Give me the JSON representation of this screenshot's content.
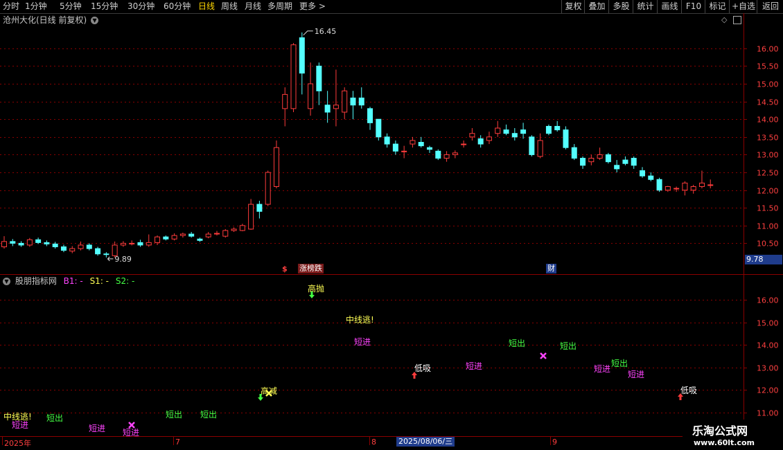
{
  "toolbar": {
    "periods": [
      "分时",
      "1分钟",
      "5分钟",
      "15分钟",
      "30分钟",
      "60分钟",
      "日线",
      "周线",
      "月线",
      "多周期",
      "更多 >"
    ],
    "active_period": "日线",
    "right_buttons": [
      "复权",
      "叠加",
      "多股",
      "统计",
      "画线",
      "F10",
      "标记",
      "+自选",
      "返回"
    ]
  },
  "main_panel": {
    "title": "沧州大化(日线 前复权)",
    "high_label": "16.45",
    "low_label": "9.89",
    "last_price_badge": "9.78",
    "event_badges": [
      "$",
      "涨榜跌",
      "财"
    ],
    "y_ticks": [
      "16.00",
      "15.50",
      "15.00",
      "14.50",
      "14.00",
      "13.50",
      "13.00",
      "12.50",
      "12.00",
      "11.50",
      "11.00",
      "10.50"
    ]
  },
  "indicator_panel": {
    "title": "股朋指标网",
    "b1_label": "B1: -",
    "s1_label": "S1: -",
    "s2_label": "S2: -",
    "y_ticks": [
      "16.00",
      "15.00",
      "14.00",
      "13.00",
      "12.00",
      "11.00"
    ],
    "signals": [
      {
        "text": "中线逃!",
        "color": "#ffff55"
      },
      {
        "text": "短进",
        "color": "#ff44ff"
      },
      {
        "text": "短出",
        "color": "#44ff44"
      },
      {
        "text": "短进",
        "color": "#ff44ff"
      },
      {
        "text": "短进",
        "color": "#ff44ff"
      },
      {
        "text": "短出",
        "color": "#44ff44"
      },
      {
        "text": "短出",
        "color": "#44ff44"
      },
      {
        "text": "高减",
        "color": "#ffff55"
      },
      {
        "text": "中线逃!",
        "color": "#ffff55"
      },
      {
        "text": "短进",
        "color": "#ff44ff"
      },
      {
        "text": "低吸",
        "color": "#ffffff"
      },
      {
        "text": "短进",
        "color": "#ff44ff"
      },
      {
        "text": "短出",
        "color": "#44ff44"
      },
      {
        "text": "短出",
        "color": "#44ff44"
      },
      {
        "text": "短进",
        "color": "#ff44ff"
      },
      {
        "text": "短出",
        "color": "#44ff44"
      },
      {
        "text": "短进",
        "color": "#ff44ff"
      },
      {
        "text": "低吸",
        "color": "#ffffff"
      },
      {
        "text": "高抛",
        "color": "#ffff55"
      }
    ]
  },
  "date_axis": {
    "labels": [
      "2025年",
      "7",
      "8",
      "9"
    ],
    "cursor_date": "2025/08/06/三"
  },
  "watermark": {
    "title": "乐淘公式网",
    "url": "www.60lt.com"
  },
  "colors": {
    "up": "#ff3c3c",
    "down": "#54ffff",
    "grid": "#8b0000",
    "accent": "#ffd700"
  },
  "chart_data": {
    "type": "candlestick",
    "title": "沧州大化(日线 前复权)",
    "ylim": [
      10.0,
      16.7
    ],
    "y_ticks": [
      10.5,
      11.0,
      11.5,
      12.0,
      12.5,
      13.0,
      13.5,
      14.0,
      14.5,
      15.0,
      15.5,
      16.0
    ],
    "high": 16.45,
    "low": 9.89,
    "candles": [
      [
        10.4,
        10.55,
        10.7,
        10.35
      ],
      [
        10.55,
        10.5,
        10.62,
        10.42
      ],
      [
        10.5,
        10.45,
        10.56,
        10.4
      ],
      [
        10.45,
        10.6,
        10.65,
        10.4
      ],
      [
        10.6,
        10.52,
        10.66,
        10.48
      ],
      [
        10.52,
        10.48,
        10.58,
        10.42
      ],
      [
        10.48,
        10.4,
        10.54,
        10.35
      ],
      [
        10.4,
        10.3,
        10.46,
        10.25
      ],
      [
        10.28,
        10.35,
        10.42,
        10.22
      ],
      [
        10.35,
        10.45,
        10.55,
        10.3
      ],
      [
        10.45,
        10.35,
        10.5,
        10.3
      ],
      [
        10.35,
        10.2,
        10.4,
        10.15
      ],
      [
        10.2,
        10.18,
        10.25,
        10.1
      ],
      [
        10.15,
        10.45,
        10.55,
        10.1
      ],
      [
        10.45,
        10.5,
        10.56,
        10.4
      ],
      [
        10.48,
        10.5,
        10.58,
        10.44
      ],
      [
        10.52,
        10.45,
        10.6,
        10.4
      ],
      [
        10.45,
        10.52,
        10.75,
        10.4
      ],
      [
        10.52,
        10.68,
        10.72,
        10.45
      ],
      [
        10.68,
        10.62,
        10.72,
        10.58
      ],
      [
        10.62,
        10.72,
        10.78,
        10.58
      ],
      [
        10.72,
        10.76,
        10.8,
        10.66
      ],
      [
        10.76,
        10.7,
        10.82,
        10.66
      ],
      [
        10.62,
        10.58,
        10.66,
        10.54
      ],
      [
        10.68,
        10.76,
        10.82,
        10.64
      ],
      [
        10.76,
        10.78,
        10.85,
        10.72
      ],
      [
        10.7,
        10.86,
        10.9,
        10.66
      ],
      [
        10.86,
        10.9,
        10.95,
        10.82
      ],
      [
        10.86,
        11.0,
        11.05,
        10.84
      ],
      [
        10.9,
        11.6,
        11.75,
        10.88
      ],
      [
        11.6,
        11.4,
        11.7,
        11.2
      ],
      [
        11.6,
        12.5,
        12.55,
        11.55
      ],
      [
        12.1,
        13.2,
        13.4,
        12.05
      ],
      [
        14.3,
        14.7,
        14.9,
        13.8
      ],
      [
        14.3,
        16.1,
        16.15,
        14.2
      ],
      [
        16.3,
        15.3,
        16.45,
        14.7
      ],
      [
        14.3,
        15.0,
        15.6,
        14.1
      ],
      [
        15.5,
        14.8,
        15.6,
        14.4
      ],
      [
        14.4,
        14.2,
        14.8,
        13.9
      ],
      [
        14.3,
        14.4,
        15.4,
        13.8
      ],
      [
        14.2,
        14.8,
        14.9,
        14.0
      ],
      [
        14.6,
        14.4,
        14.8,
        14.0
      ],
      [
        14.6,
        14.4,
        14.9,
        14.3
      ],
      [
        14.3,
        13.9,
        14.35,
        13.7
      ],
      [
        14.0,
        13.5,
        14.0,
        13.4
      ],
      [
        13.5,
        13.3,
        13.6,
        13.2
      ],
      [
        13.3,
        13.1,
        13.4,
        13.0
      ],
      [
        13.1,
        13.1,
        13.25,
        12.9
      ],
      [
        13.3,
        13.4,
        13.5,
        13.2
      ],
      [
        13.35,
        13.25,
        13.5,
        13.2
      ],
      [
        13.2,
        13.15,
        13.25,
        13.05
      ],
      [
        13.1,
        12.9,
        13.15,
        12.85
      ],
      [
        12.9,
        13.0,
        13.1,
        12.8
      ],
      [
        13.0,
        13.05,
        13.12,
        12.9
      ],
      [
        13.3,
        13.3,
        13.4,
        13.2
      ],
      [
        13.5,
        13.6,
        13.75,
        13.4
      ],
      [
        13.45,
        13.3,
        13.55,
        13.2
      ],
      [
        13.4,
        13.5,
        13.65,
        13.3
      ],
      [
        13.6,
        13.75,
        13.95,
        13.5
      ],
      [
        13.7,
        13.6,
        13.85,
        13.55
      ],
      [
        13.6,
        13.5,
        13.75,
        13.4
      ],
      [
        13.7,
        13.6,
        13.9,
        13.45
      ],
      [
        13.5,
        13.0,
        13.55,
        12.95
      ],
      [
        12.95,
        13.4,
        13.6,
        12.9
      ],
      [
        13.8,
        13.6,
        13.85,
        13.55
      ],
      [
        13.8,
        13.7,
        13.95,
        13.65
      ],
      [
        13.7,
        13.2,
        13.8,
        13.15
      ],
      [
        13.2,
        12.9,
        13.3,
        12.85
      ],
      [
        12.9,
        12.7,
        12.95,
        12.6
      ],
      [
        12.8,
        12.9,
        13.0,
        12.7
      ],
      [
        12.9,
        13.0,
        13.2,
        12.85
      ],
      [
        13.0,
        12.8,
        13.05,
        12.75
      ],
      [
        12.7,
        12.6,
        12.85,
        12.5
      ],
      [
        12.85,
        12.75,
        12.95,
        12.7
      ],
      [
        12.9,
        12.7,
        12.95,
        12.6
      ],
      [
        12.55,
        12.4,
        12.65,
        12.35
      ],
      [
        12.4,
        12.3,
        12.5,
        12.25
      ],
      [
        12.3,
        12.0,
        12.35,
        11.95
      ],
      [
        12.0,
        12.1,
        12.12,
        11.95
      ],
      [
        12.05,
        12.05,
        12.1,
        11.95
      ],
      [
        12.0,
        12.2,
        12.25,
        11.85
      ],
      [
        12.0,
        12.1,
        12.15,
        11.9
      ],
      [
        12.1,
        12.2,
        12.55,
        12.05
      ],
      [
        12.15,
        12.15,
        12.3,
        12.05
      ]
    ]
  }
}
